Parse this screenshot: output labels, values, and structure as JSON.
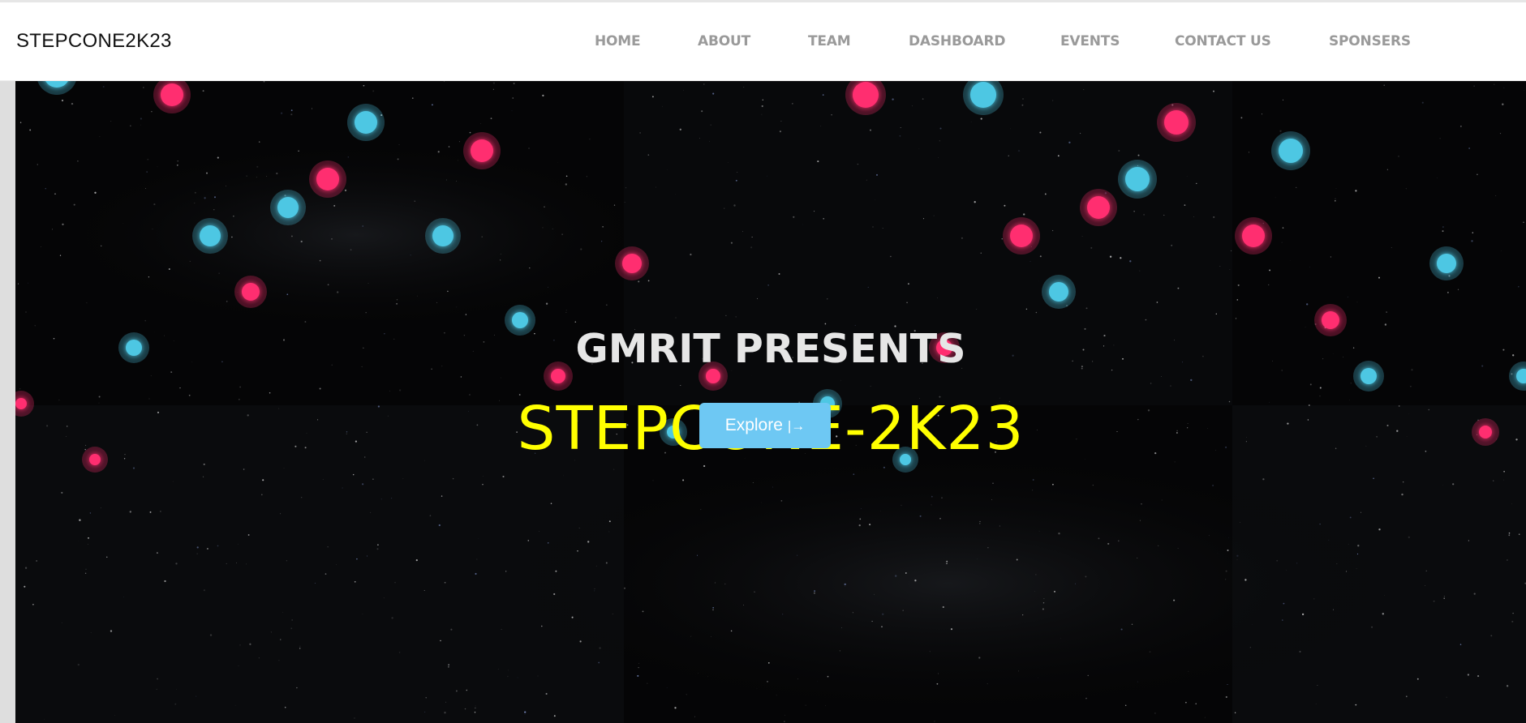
{
  "brand": {
    "name": "STEPCONE2K23"
  },
  "nav": {
    "items": [
      {
        "label": "HOME"
      },
      {
        "label": "ABOUT"
      },
      {
        "label": "TEAM"
      },
      {
        "label": "DASHBOARD"
      },
      {
        "label": "EVENTS"
      },
      {
        "label": "CONTACT US"
      },
      {
        "label": "SPONSERS"
      }
    ]
  },
  "hero": {
    "subtitle": "GMRIT PRESENTS",
    "title": "STEPCONE-2K23",
    "cta_label": "Explore",
    "cta_icon": "arrow-right-to-line-icon"
  },
  "colors": {
    "nav_text": "#9a9a9a",
    "title_yellow": "#ffff00",
    "subtitle_white": "#e6e6e6",
    "button_blue": "#6ec8f3",
    "particle_pink": "#ff2d6f",
    "particle_cyan": "#4ec7e3",
    "background": "#050506"
  }
}
